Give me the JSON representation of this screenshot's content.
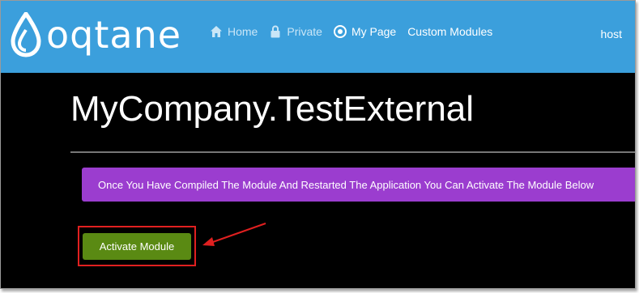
{
  "brand": {
    "name": "oqtane"
  },
  "nav": {
    "items": [
      {
        "label": "Home",
        "icon": "home-icon"
      },
      {
        "label": "Private",
        "icon": "lock-icon"
      },
      {
        "label": "My Page",
        "icon": "target-icon"
      },
      {
        "label": "Custom Modules",
        "icon": ""
      }
    ],
    "user": "host"
  },
  "page": {
    "title": "MyCompany.TestExternal",
    "alert": "Once You Have Compiled The Module And Restarted The Application You Can Activate The Module Below",
    "button_label": "Activate Module"
  },
  "colors": {
    "navbar": "#3b9fdc",
    "alert": "#9b3dcf",
    "button": "#5a8a13",
    "highlight": "#e02020"
  }
}
